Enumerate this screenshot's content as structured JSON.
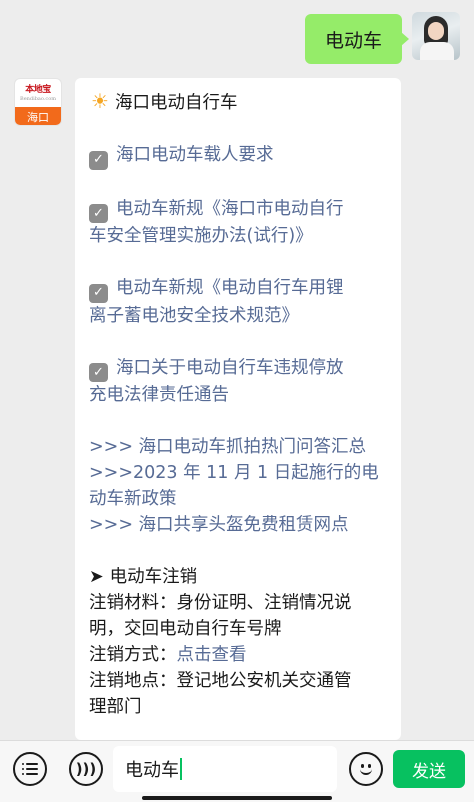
{
  "outgoing_message": {
    "text": "电动车"
  },
  "bot": {
    "logo_name": "本地宝",
    "logo_url": "Bendibao.com",
    "logo_city": "海口"
  },
  "incoming_message": {
    "title": "海口电动自行车",
    "checklist": [
      {
        "lines": [
          "海口电动车载人要求"
        ]
      },
      {
        "lines": [
          "电动车新规《海口市电动自行",
          "车安全管理实施办法(试行)》"
        ]
      },
      {
        "lines": [
          "电动车新规《电动自行车用锂",
          "离子蓄电池安全技术规范》"
        ]
      },
      {
        "lines": [
          "海口关于电动自行车违规停放",
          "充电法律责任通告"
        ]
      }
    ],
    "links": {
      "item1": ">>> 海口电动车抓拍热门问答汇总",
      "item2_line1": ">>>2023 年 11 月 1 日起施行的电",
      "item2_line2": "动车新政策",
      "item3": ">>> 海口共享头盔免费租赁网点"
    },
    "cancel_section": {
      "heading": "电动车注销",
      "materials_line1": "注销材料：身份证明、注销情况说",
      "materials_line2": "明，交回电动自行车号牌",
      "method_label": "注销方式：",
      "method_link": "点击查看",
      "location_line1": "注销地点：登记地公安机关交通管",
      "location_line2": "理部门"
    }
  },
  "input_bar": {
    "input_value": "电动车",
    "send_label": "发送"
  },
  "colors": {
    "background": "#ededed",
    "outgoing_bubble": "#95ec69",
    "link": "#576b95",
    "send_button": "#07c160"
  },
  "icons": {
    "title_icon": "sun-icon",
    "check_icon": "checkbox-checked-icon",
    "bullet_icon": "arrowhead-icon",
    "left_button": "menu-icon",
    "voice_button": "voice-icon",
    "emoji_button": "emoji-icon"
  }
}
